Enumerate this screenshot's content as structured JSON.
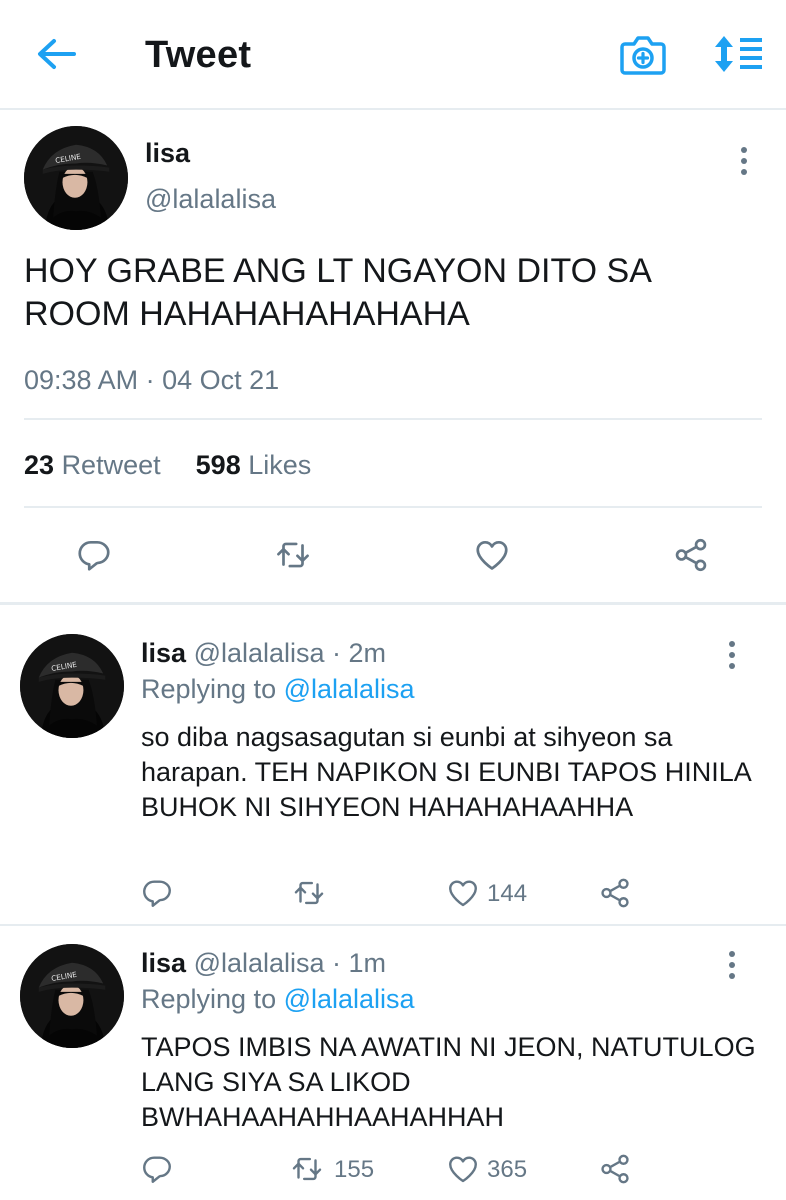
{
  "header": {
    "title": "Tweet",
    "back_icon": "back-arrow-icon",
    "camera_icon": "camera-plus-icon",
    "sort_icon": "sort-icon",
    "accent": "#1da1f2"
  },
  "main_tweet": {
    "name": "lisa",
    "handle": "@lalalalisa",
    "text": "HOY GRABE ANG LT NGAYON DITO SA ROOM HAHAHAHAHAHAHA",
    "timestamp": "09:38 AM · 04 Oct 21",
    "retweet_count": "23",
    "retweet_label": "Retweet",
    "like_count": "598",
    "like_label": "Likes"
  },
  "replies": [
    {
      "name": "lisa",
      "handle_time": "@lalalalisa · 2m",
      "replying_prefix": "Replying to",
      "replying_to": "@lalalalisa",
      "text": "so diba nagsasagutan si eunbi at sihyeon sa harapan. TEH NAPIKON SI EUNBI TAPOS HINILA BUHOK NI SIHYEON HAHAHAHAAHHA",
      "retweets": "",
      "likes": "144"
    },
    {
      "name": "lisa",
      "handle_time": "@lalalalisa · 1m",
      "replying_prefix": "Replying to",
      "replying_to": "@lalalalisa",
      "text": "TAPOS IMBIS NA AWATIN NI JEON, NATUTULOG LANG SIYA SA LIKOD BWHAHAAHAHHAAHAHHAH",
      "retweets": "155",
      "likes": "365"
    }
  ],
  "colors": {
    "text": "#14171a",
    "secondary": "#657786",
    "divider": "#e6ecf0"
  }
}
